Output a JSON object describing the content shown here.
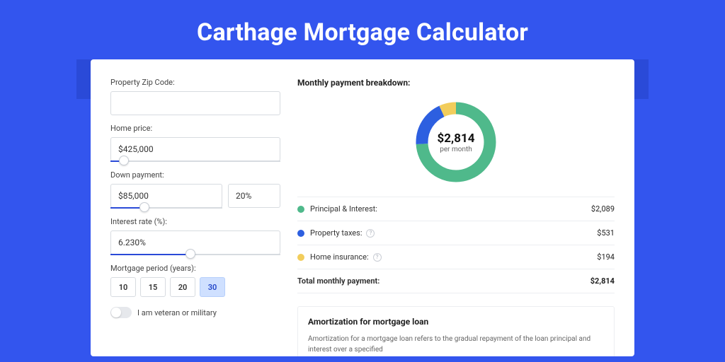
{
  "title": "Carthage Mortgage Calculator",
  "form": {
    "zip_label": "Property Zip Code:",
    "zip_value": "",
    "home_price_label": "Home price:",
    "home_price_value": "$425,000",
    "home_price_slider_pct": 8,
    "down_payment_label": "Down payment:",
    "down_payment_value": "$85,000",
    "down_payment_pct": "20%",
    "down_payment_slider_pct": 30,
    "interest_label": "Interest rate (%):",
    "interest_value": "6.230%",
    "interest_slider_pct": 47,
    "period_label": "Mortgage period (years):",
    "periods": [
      "10",
      "15",
      "20",
      "30"
    ],
    "period_active": "30",
    "veteran_label": "I am veteran or military",
    "veteran_on": false
  },
  "breakdown": {
    "title": "Monthly payment breakdown:",
    "center_amount": "$2,814",
    "center_per": "per month",
    "items": [
      {
        "name": "Principal & Interest:",
        "value": "$2,089",
        "color": "#4fb98b",
        "info": false,
        "pct": 74
      },
      {
        "name": "Property taxes:",
        "value": "$531",
        "color": "#2d5fe0",
        "info": true,
        "pct": 19
      },
      {
        "name": "Home insurance:",
        "value": "$194",
        "color": "#f2cd5c",
        "info": true,
        "pct": 7
      }
    ],
    "total_label": "Total monthly payment:",
    "total_value": "$2,814"
  },
  "amort": {
    "title": "Amortization for mortgage loan",
    "body": "Amortization for a mortgage loan refers to the gradual repayment of the loan principal and interest over a specified"
  },
  "chart_data": {
    "type": "pie",
    "title": "Monthly payment breakdown",
    "series": [
      {
        "name": "Principal & Interest",
        "value": 2089,
        "color": "#4fb98b"
      },
      {
        "name": "Property taxes",
        "value": 531,
        "color": "#2d5fe0"
      },
      {
        "name": "Home insurance",
        "value": 194,
        "color": "#f2cd5c"
      }
    ],
    "total": 2814,
    "center_label": "$2,814 per month"
  }
}
